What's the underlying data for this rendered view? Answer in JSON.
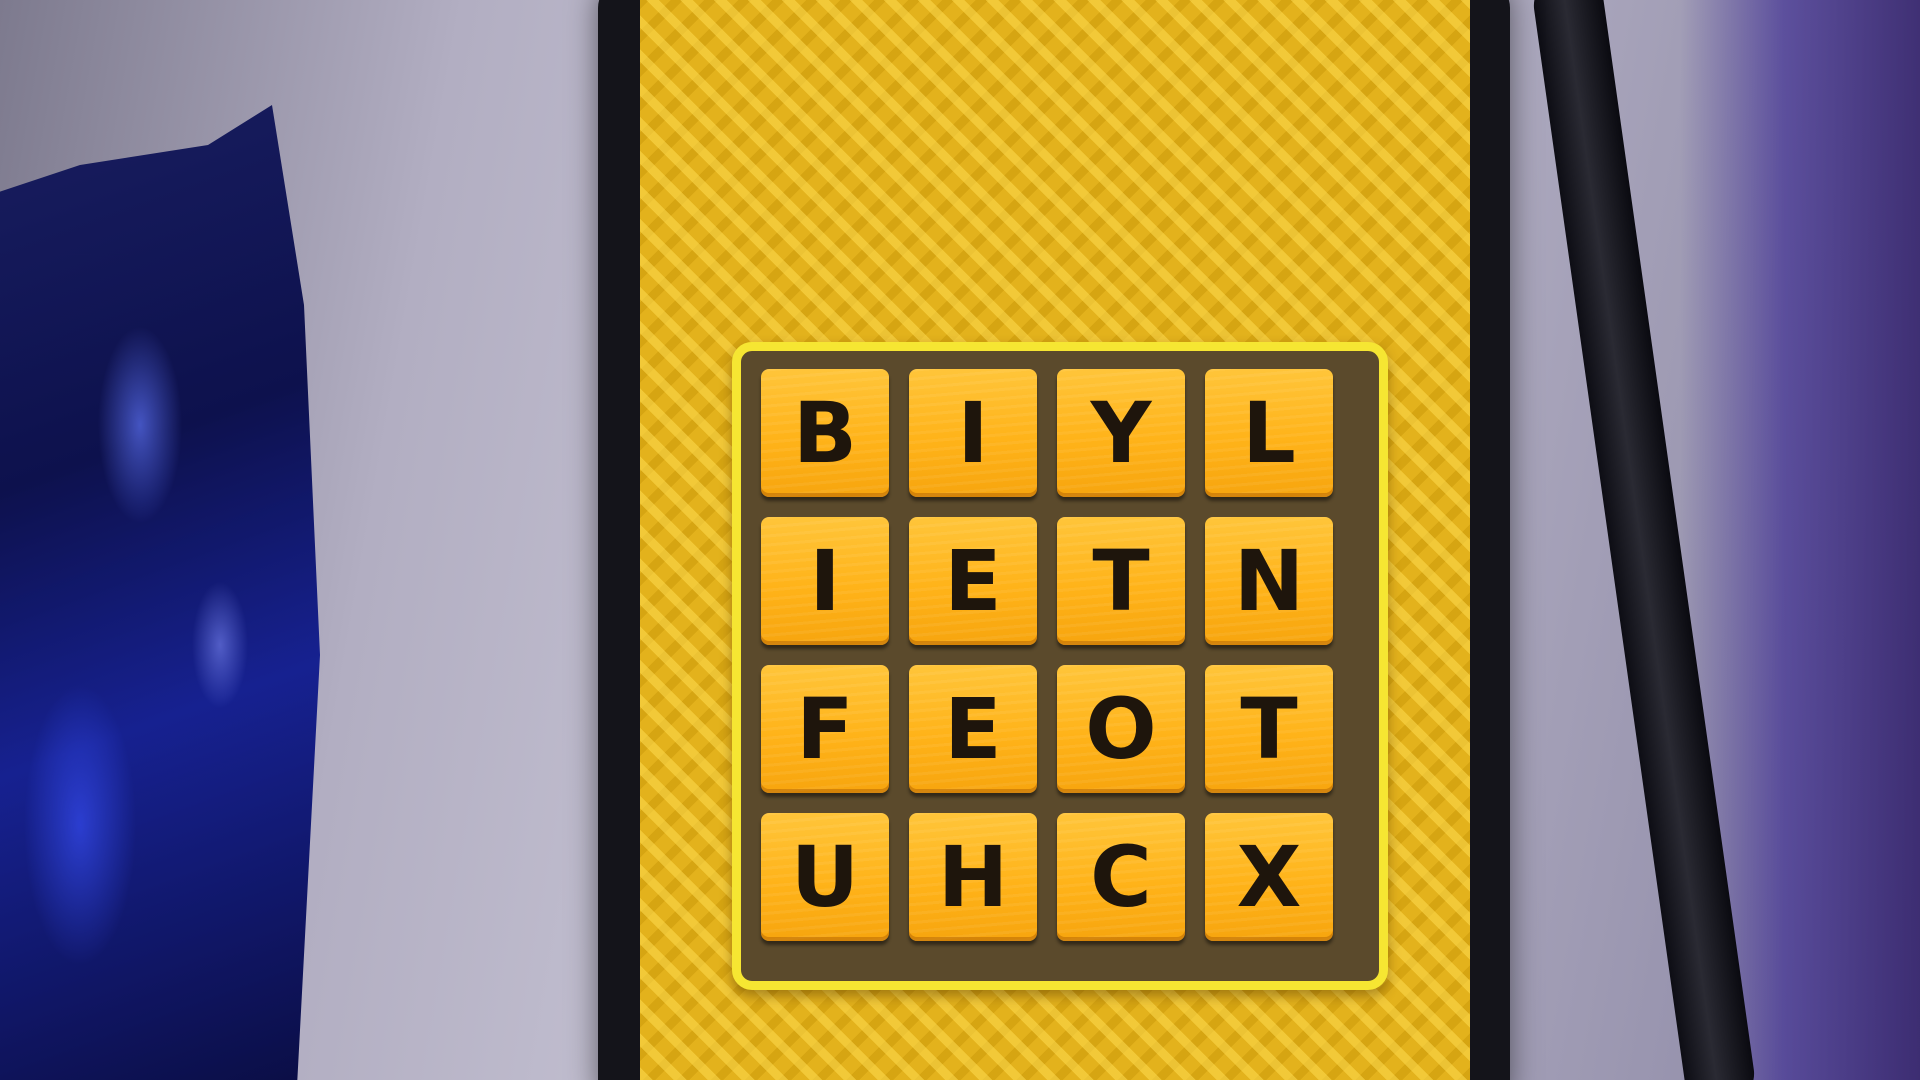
{
  "board": {
    "rows": [
      [
        "B",
        "I",
        "Y",
        "L"
      ],
      [
        "I",
        "E",
        "T",
        "N"
      ],
      [
        "F",
        "E",
        "O",
        "T"
      ],
      [
        "U",
        "H",
        "C",
        "X"
      ]
    ]
  },
  "colors": {
    "screen_background": "#e3b21c",
    "board_border": "#f6e632",
    "board_background": "#5b4a2c",
    "tile": "#ffb319",
    "letter": "#1e150c"
  }
}
